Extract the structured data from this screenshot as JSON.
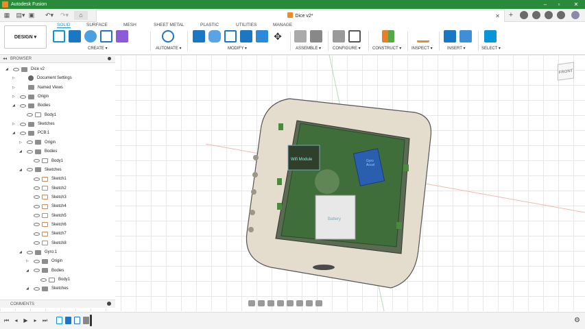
{
  "app": {
    "title": "Autodesk Fusion"
  },
  "document": {
    "tab_title": "Dice v2*"
  },
  "ribbon": {
    "workspace": "DESIGN",
    "tabs": [
      "SOLID",
      "SURFACE",
      "MESH",
      "SHEET METAL",
      "PLASTIC",
      "UTILITIES",
      "MANAGE"
    ],
    "active_tab": "SOLID",
    "groups": [
      "CREATE",
      "AUTOMATE",
      "MODIFY",
      "ASSEMBLE",
      "CONFIGURE",
      "CONSTRUCT",
      "INSPECT",
      "INSERT",
      "SELECT"
    ]
  },
  "browser": {
    "title": "BROWSER",
    "items": [
      {
        "label": "Dice v2",
        "icon": "document-icon"
      },
      {
        "label": "Document Settings",
        "icon": "gear-icon"
      },
      {
        "label": "Named Views",
        "icon": "folder-icon"
      },
      {
        "label": "Origin",
        "icon": "folder-icon"
      },
      {
        "label": "Bodies",
        "icon": "folder-icon"
      },
      {
        "label": "Body1",
        "icon": "body-icon"
      },
      {
        "label": "Sketches",
        "icon": "folder-icon"
      },
      {
        "label": "PCB:1",
        "icon": "component-icon"
      },
      {
        "label": "Origin",
        "icon": "folder-icon"
      },
      {
        "label": "Bodies",
        "icon": "folder-icon"
      },
      {
        "label": "Body1",
        "icon": "body-icon"
      },
      {
        "label": "Sketches",
        "icon": "folder-icon"
      },
      {
        "label": "Sketch1",
        "icon": "sketch-icon"
      },
      {
        "label": "Sketch2",
        "icon": "sketch-icon"
      },
      {
        "label": "Sketch3",
        "icon": "sketch-icon"
      },
      {
        "label": "Sketch4",
        "icon": "sketch-icon"
      },
      {
        "label": "Sketch5",
        "icon": "sketch-icon"
      },
      {
        "label": "Sketch6",
        "icon": "sketch-icon"
      },
      {
        "label": "Sketch7",
        "icon": "sketch-icon"
      },
      {
        "label": "Sketch8",
        "icon": "sketch-icon"
      },
      {
        "label": "Gyro:1",
        "icon": "component-icon"
      },
      {
        "label": "Origin",
        "icon": "folder-icon"
      },
      {
        "label": "Bodies",
        "icon": "folder-icon"
      },
      {
        "label": "Body1",
        "icon": "body-icon"
      },
      {
        "label": "Sketches",
        "icon": "folder-icon"
      }
    ]
  },
  "comments": {
    "title": "COMMENTS"
  },
  "viewcube": {
    "face_label": "FRONT"
  },
  "model_labels": {
    "module": "Wifi Module",
    "battery": "Battery",
    "gyro": "Gyro Accel"
  },
  "colors": {
    "title_bar": "#2a8a3c",
    "accent": "#0696d7",
    "pcb": "#3f6e3a",
    "dice_shell": "#e4dccd"
  }
}
